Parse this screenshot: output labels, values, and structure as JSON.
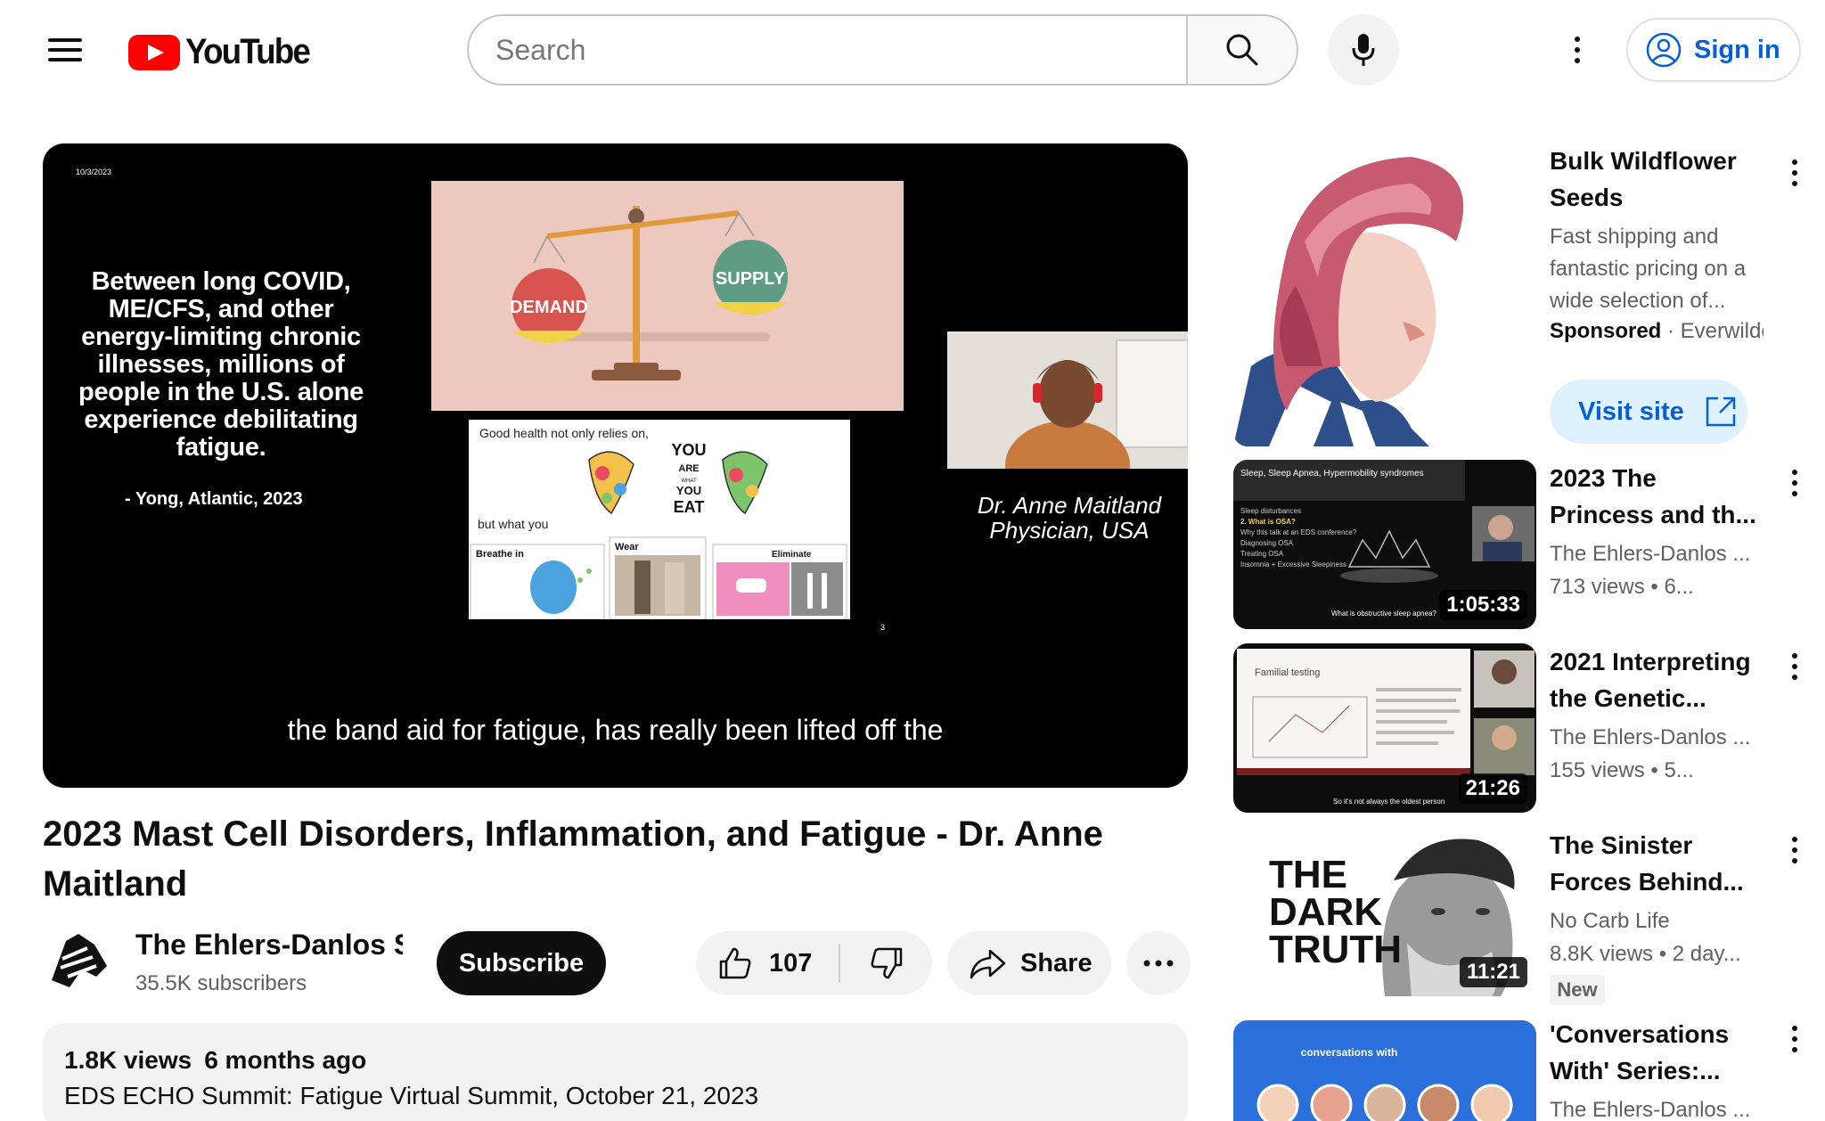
{
  "header": {
    "logo_text": "YouTube",
    "search_placeholder": "Search",
    "sign_in_label": "Sign in"
  },
  "player": {
    "slide_date": "10/3/2023",
    "slide_quote": "Between long COVID, ME/CFS, and other energy-limiting chronic illnesses, millions of people in the U.S. alone experience debilitating fatigue.",
    "slide_cite": "- Yong, Atlantic, 2023",
    "scale_demand": "DEMAND",
    "scale_supply": "SUPPLY",
    "panel_text_1": "Good health not only relies on,",
    "panel_you_are": "YOU",
    "panel_are": "ARE",
    "panel_what": "WHAT",
    "panel_you2": "YOU",
    "panel_eat": "EAT",
    "panel_text_2": "but what you",
    "panel_breathe": "Breathe in",
    "panel_wear": "Wear",
    "panel_eliminate": "Eliminate",
    "slide_number": "3",
    "speaker_name": "Dr. Anne Maitland",
    "speaker_role": "Physician, USA",
    "caption": "the band aid for fatigue, has really been lifted off the"
  },
  "video": {
    "title": "2023 Mast Cell Disorders, Inflammation, and Fatigue - Dr. Anne Maitland",
    "channel_name": "The Ehlers-Danlos Society",
    "subscribers": "35.5K subscribers",
    "subscribe_label": "Subscribe",
    "like_count": "107",
    "share_label": "Share",
    "views": "1.8K views",
    "age": "6 months ago",
    "description_first_line": "EDS ECHO Summit: Fatigue Virtual Summit, October 21, 2023"
  },
  "ad": {
    "title": "Bulk Wildflower Seeds",
    "description": "Fast shipping and fantastic pricing on a wide selection of...",
    "sponsored_label": "Sponsored",
    "advertiser": "Everwilde",
    "visit_label": "Visit site"
  },
  "recommendations": [
    {
      "title": "2023 The Princess and th...",
      "channel": "The Ehlers-Danlos ...",
      "stats": "713 views  • 6...",
      "duration": "1:05:33",
      "thumb_heading": "Sleep, Sleep Apnea, Hypermobility syndromes",
      "thumb_caption": "What is obstructive sleep apnea?"
    },
    {
      "title": "2021 Interpreting the Genetic...",
      "channel": "The Ehlers-Danlos ...",
      "stats": "155 views  • 5...",
      "duration": "21:26",
      "thumb_heading": "Familial testing",
      "thumb_caption": "So it's not always the oldest person"
    },
    {
      "title": "The Sinister Forces Behind...",
      "channel": "No Carb Life",
      "stats": "8.8K views  • 2 day...",
      "duration": "11:21",
      "badge": "New",
      "thumb_text": "THE DARK TRUTH"
    },
    {
      "title": "'Conversations With' Series:...",
      "channel": "The Ehlers-Danlos ...",
      "thumb_text": "conversations with"
    }
  ],
  "colors": {
    "brand_red": "#ff0000",
    "link_blue": "#065fd4",
    "chip_gray": "#f2f2f2",
    "visit_bg": "#def1ff"
  }
}
